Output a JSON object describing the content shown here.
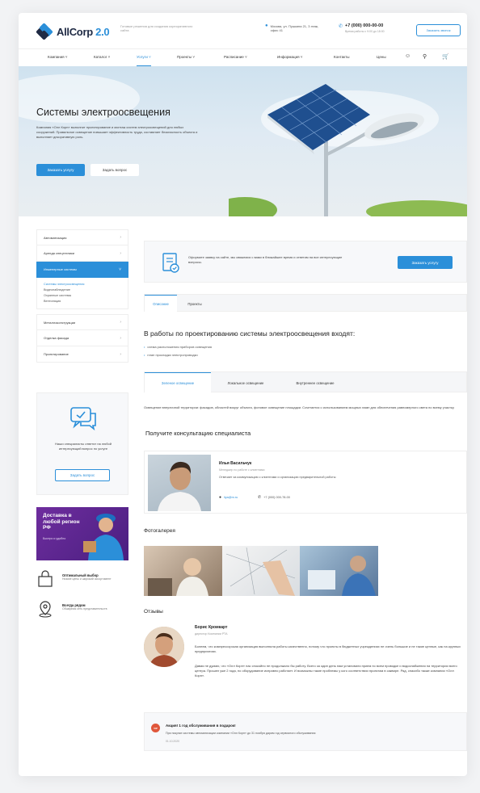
{
  "header": {
    "logo_text": "AllCorp",
    "logo_version": "2.0",
    "slogan": "Готовые решения для создания корпоративного сайта",
    "address": "Москва, ул. Пушкина 21, 3 этаж, офис 41",
    "phone": "+7 (000) 000-00-00",
    "phone_hours": "Время работы с 9:00 до 18:00",
    "callback_label": "Заказать звонок"
  },
  "nav": {
    "items": [
      "Компания",
      "Каталог",
      "Услуги",
      "Проекты",
      "Расписание",
      "Информация",
      "Контакты",
      "Цены"
    ],
    "active": "Услуги"
  },
  "hero": {
    "title": "Системы электроосвещения",
    "text": "Компания «Олл Корп» выполнит проектирование и монтаж систем электроосвещений для любых сооружений. Правильное освещение повышает эффективность труда, составляет безопасность объекта и выполняет декоративную роль.",
    "btn_order": "Заказать услугу",
    "btn_ask": "Задать вопрос"
  },
  "sidebar": {
    "items": [
      "Автоматизация",
      "Аренда спецтехники",
      "Инженерные системы",
      "Металлоконструкции",
      "Отделка фасада",
      "Проектирование"
    ],
    "sub_items": [
      "Системы электроосвещения",
      "Видеонаблюдение",
      "Охранные системы",
      "Вентиляция"
    ]
  },
  "ask_box": {
    "text": "Наши специалисты ответят на любой интересующий вопрос по услуге",
    "btn": "Задать вопрос"
  },
  "promo": {
    "title": "Доставка в любой регион РФ",
    "sub": "Быстро и удобно"
  },
  "features": [
    {
      "title": "Оптимальный выбор",
      "text": "Низкие цены и широкий ассортимент"
    },
    {
      "title": "Всегда рядом",
      "text": "Обширная сеть представительств"
    }
  ],
  "order_box": {
    "text": "Оформите заявку на сайте, мы свяжемся с вами в ближайшее время и ответим на все интересующие вопросы.",
    "btn": "Заказать услугу"
  },
  "tabs_main": [
    "Описание",
    "Проекты"
  ],
  "content": {
    "heading": "В работы по проектированию системы электроосвещения входят:",
    "bullets": [
      "схема расположения приборов освещения",
      "план прокладки электропроводки"
    ],
    "tabs_lighting": [
      "Зеленое освещение",
      "Локальное освещение",
      "Внутреннее освещение"
    ],
    "para": "Освещение внеуличной территории: фасадов, областей вокруг объекта, фоновое освещение площадки. Сочетается с использованием мощных ламп для обеспечения равномерного света по всему участку.",
    "consult_heading": "Получите консультацию специалиста"
  },
  "specialist": {
    "name": "Илья Васильчук",
    "role": "Менеджер по работе с клиентами",
    "desc": "Отвечает за коммуникацию с клиентами и организацию предварительной работы",
    "email": "ilya@m.ru",
    "tel": "+7 (000) 000-78-00"
  },
  "gallery_heading": "Фотогалерея",
  "reviews_heading": "Отзывы",
  "review": {
    "name": "Борис Кромкарт",
    "role": "директор Компании РТА",
    "p1": "Болеем, что компрессорская организация выполнила работы качественно, потому что проекты в бюджетных учреждениях не очень большие и не такие ценные, как на крупных предприятиях.",
    "p2": "Давая не думаю, что «Олл Корп» нас спокойно не продолжало бы работу. Всего за один день нам установили прием по всем проводке и водоснабжения на территории всего центра. Прошел уже 2 года, но оборудование исправно работает. И возможны такие проблемы у кого соответствии проектам в саквире. Ряд, спасибо также компании «Олл Корп»."
  },
  "news": {
    "badge": "VIP",
    "title": "Акция! 1 год обслуживания в подарок!",
    "text": "При покупке системы автоматизации компании «Олл Корп» до 31 ноября дарим год сервисного обслуживания",
    "date": "01.10.2020"
  },
  "colors": {
    "accent": "#2b8fd9",
    "promo": "#5a2590"
  }
}
